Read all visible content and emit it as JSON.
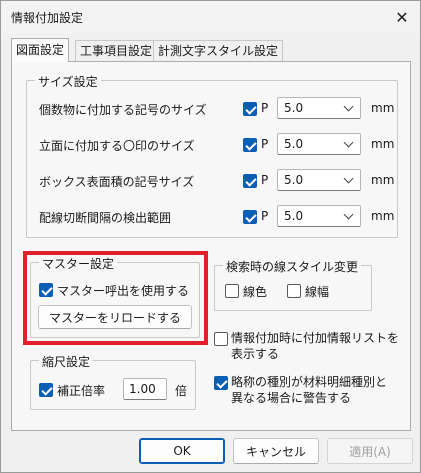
{
  "window": {
    "title": "情報付加設定"
  },
  "tabs": [
    {
      "label": "図面設定",
      "active": true
    },
    {
      "label": "工事項目設定",
      "active": false
    },
    {
      "label": "計測文字スタイル設定",
      "active": false
    }
  ],
  "size_settings": {
    "title": "サイズ設定",
    "rows": [
      {
        "label": "個数物に付加する記号のサイズ",
        "check_label": "P",
        "checked": true,
        "value": "5.0",
        "unit": "mm"
      },
      {
        "label": "立面に付加する〇印のサイズ",
        "check_label": "P",
        "checked": true,
        "value": "5.0",
        "unit": "mm"
      },
      {
        "label": "ボックス表面積の記号サイズ",
        "check_label": "P",
        "checked": true,
        "value": "5.0",
        "unit": "mm"
      },
      {
        "label": "配線切断間隔の検出範囲",
        "check_label": "P",
        "checked": true,
        "value": "5.0",
        "unit": "mm"
      }
    ]
  },
  "master": {
    "title": "マスター設定",
    "use_master_label": "マスター呼出を使用する",
    "use_master_checked": true,
    "reload_label": "マスターをリロードする"
  },
  "search_style": {
    "title": "検索時の線スタイル変更",
    "color_label": "線色",
    "color_checked": false,
    "width_label": "線幅",
    "width_checked": false
  },
  "scale": {
    "title": "縮尺設定",
    "correction_label": "補正倍率",
    "correction_checked": true,
    "value": "1.00",
    "unit": "倍"
  },
  "options": {
    "show_list_label": "情報付加時に付加情報リストを表示する",
    "show_list_line1": "情報付加時に付加情報リストを",
    "show_list_line2": "表示する",
    "show_list_checked": false,
    "warn_label_line1": "略称の種別が材料明細種別と",
    "warn_label_line2": "異なる場合に警告する",
    "warn_checked": true
  },
  "footer": {
    "ok": "OK",
    "cancel": "キャンセル",
    "apply": "適用(A)"
  },
  "colors": {
    "accent": "#0a5fb4",
    "highlight": "#e0202a"
  }
}
